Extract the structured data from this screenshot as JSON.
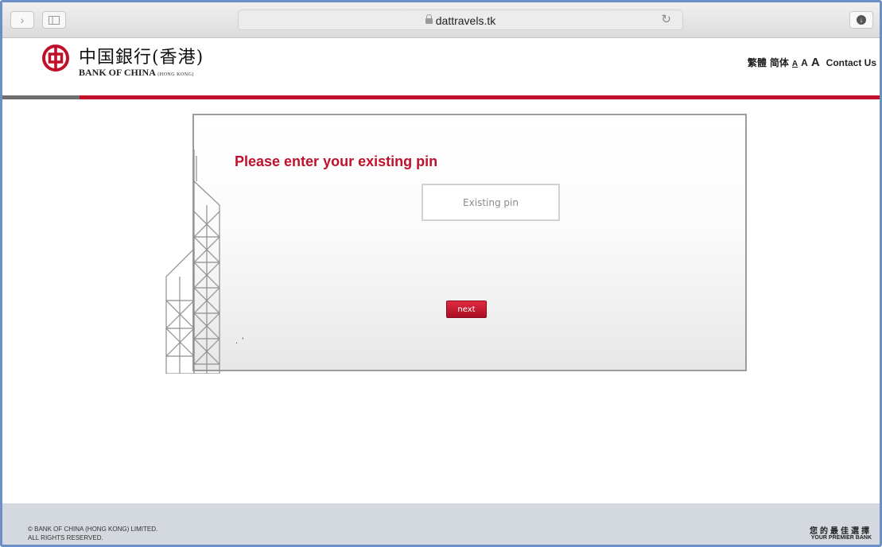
{
  "browser": {
    "url": "dattravels.tk"
  },
  "header": {
    "brand_cn": "中国銀行(香港)",
    "brand_en": "BANK OF CHINA",
    "brand_en_sub": "(HONG KONG)",
    "links": {
      "traditional": "繁體",
      "simplified": "简体",
      "size_small": "A",
      "size_medium": "A",
      "size_large": "A",
      "contact": "Contact Us"
    }
  },
  "form": {
    "title": "Please enter your existing pin",
    "pin_placeholder": "Existing pin",
    "pin_value": "",
    "next_label": "next",
    "dots": ". '"
  },
  "footer": {
    "copyright_line1": "© BANK OF CHINA (HONG KONG) LIMITED.",
    "copyright_line2": "ALL RIGHTS RESERVED.",
    "tagline_cn": "您的最佳選擇",
    "tagline_en": "YOUR PREMIER BANK"
  },
  "colors": {
    "accent_red": "#c0102a",
    "footer_bg": "#d3d9de",
    "window_border": "#6b8fc7"
  },
  "icons": {
    "back": "chevron-right-icon",
    "sidebar": "sidebar-icon",
    "lock": "lock-icon",
    "reload": "reload-icon",
    "download": "download-icon",
    "logo": "bank-of-china-logo-icon"
  }
}
